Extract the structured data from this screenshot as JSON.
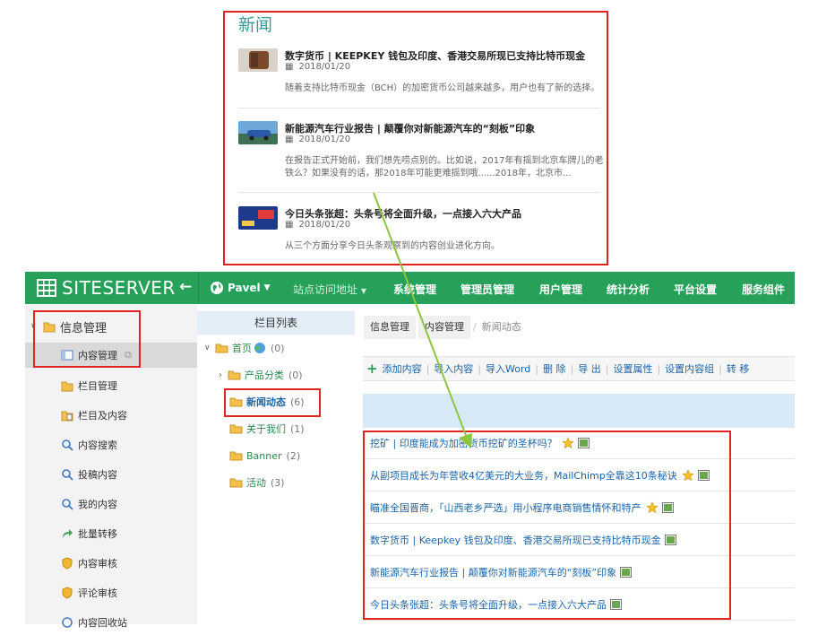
{
  "news": {
    "title": "新闻",
    "items": [
      {
        "headline": "数字货币 | KEEPKEY 钱包及印度、香港交易所现已支持比特币现金",
        "date": "2018/01/20",
        "summary": "随着支持比特币现金（BCH）的加密货币公司越来越多，用户也有了新的选择。"
      },
      {
        "headline": "新能源汽车行业报告 | 颠覆你对新能源汽车的“刻板”印象",
        "date": "2018/01/20",
        "summary": "在报告正式开始前，我们想先唠点别的。比如说，2017年有摇到北京车牌儿的老铁么？如果没有的话，那2018年可能更难摇到哦......2018年，北京市..."
      },
      {
        "headline": "今日头条张超：头条号将全面升级，一点接入六大产品",
        "date": "2018/01/20",
        "summary": "从三个方面分享今日头条观察到的内容创业进化方向。"
      }
    ]
  },
  "topbar": {
    "brand": "SITESERVER",
    "back": "←",
    "user": "Pavel",
    "nav": [
      "站点访问地址",
      "系统管理",
      "管理员管理",
      "用户管理",
      "统计分析",
      "平台设置",
      "服务组件"
    ]
  },
  "leftmenu": {
    "group": "信息管理",
    "items": [
      {
        "label": "内容管理",
        "icon": "content-icon",
        "active": true
      },
      {
        "label": "栏目管理",
        "icon": "folder-icon"
      },
      {
        "label": "栏目及内容",
        "icon": "folder-doc-icon"
      },
      {
        "label": "内容搜索",
        "icon": "search-icon"
      },
      {
        "label": "投稿内容",
        "icon": "search-icon"
      },
      {
        "label": "我的内容",
        "icon": "search-icon"
      },
      {
        "label": "批量转移",
        "icon": "arrow-icon"
      },
      {
        "label": "内容审核",
        "icon": "shield-icon"
      },
      {
        "label": "评论审核",
        "icon": "shield-icon"
      },
      {
        "label": "内容回收站",
        "icon": "recycle-icon"
      }
    ]
  },
  "tree": {
    "header": "栏目列表",
    "nodes": [
      {
        "label": "首页",
        "count": "(0)"
      },
      {
        "label": "产品分类",
        "count": "(0)"
      },
      {
        "label": "新闻动态",
        "count": "(6)"
      },
      {
        "label": "关于我们",
        "count": "(1)"
      },
      {
        "label": "Banner",
        "count": "(2)"
      },
      {
        "label": "活动",
        "count": "(3)"
      }
    ]
  },
  "main": {
    "breadcrumb": [
      "信息管理",
      "内容管理",
      "新闻动态"
    ],
    "toolbar": [
      "添加内容",
      "导入内容",
      "导入Word",
      "删 除",
      "导 出",
      "设置属性",
      "设置内容组",
      "转 移"
    ],
    "rows": [
      {
        "title": "挖矿 | 印度能成为加密货币挖矿的圣杯吗？",
        "star": true
      },
      {
        "title": "从副项目成长为年营收4亿美元的大业务，MailChimp全靠这10条秘诀",
        "star": true
      },
      {
        "title": "瞄准全国晋商，「山西老乡严选」用小程序电商销售情怀和特产",
        "star": true
      },
      {
        "title": "数字货币 | Keepkey 钱包及印度、香港交易所现已支持比特币现金",
        "star": false
      },
      {
        "title": "新能源汽车行业报告 | 颠覆你对新能源汽车的“刻板”印象",
        "star": false
      },
      {
        "title": "今日头条张超：头条号将全面升级，一点接入六大产品",
        "star": false
      }
    ]
  },
  "colors": {
    "brand_green": "#27a05a",
    "link_blue": "#1a64a8",
    "annotation_red": "#e02424",
    "arrow_green": "#8cc63f"
  }
}
